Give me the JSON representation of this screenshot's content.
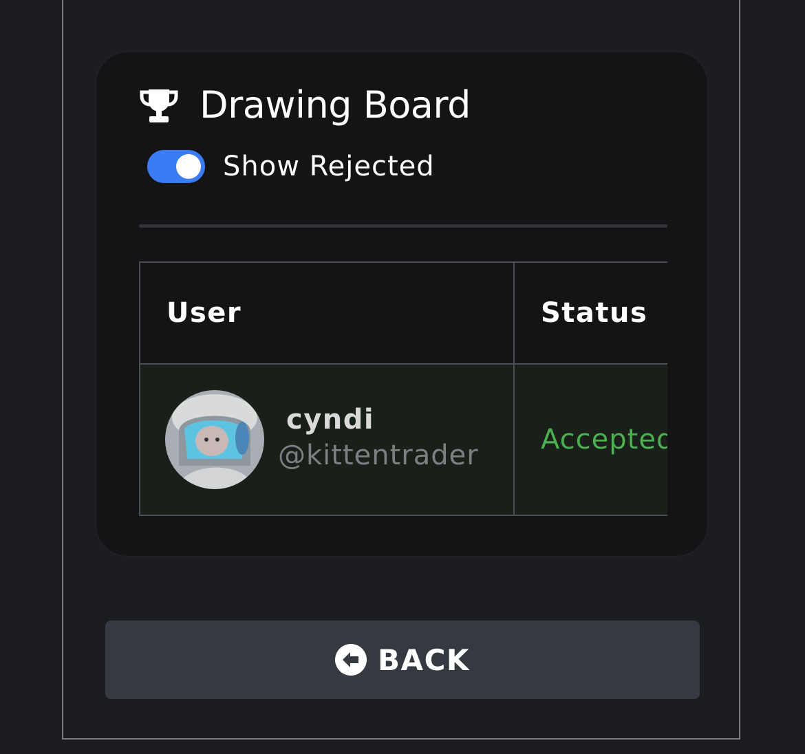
{
  "card": {
    "title": "Drawing Board",
    "title_icon": "trophy-icon",
    "toggle": {
      "label": "Show Rejected",
      "checked": true,
      "accent_color": "#3b7cf4"
    }
  },
  "table": {
    "headers": [
      "User",
      "Status"
    ],
    "rows": [
      {
        "user": {
          "name": "cyndi",
          "handle": "@kittentrader"
        },
        "status": "Accepted",
        "status_color": "#4caf50",
        "row_highlight_color": "#182019"
      }
    ]
  },
  "footer": {
    "back_label": "BACK",
    "back_icon": "arrow-left-circle-icon"
  }
}
